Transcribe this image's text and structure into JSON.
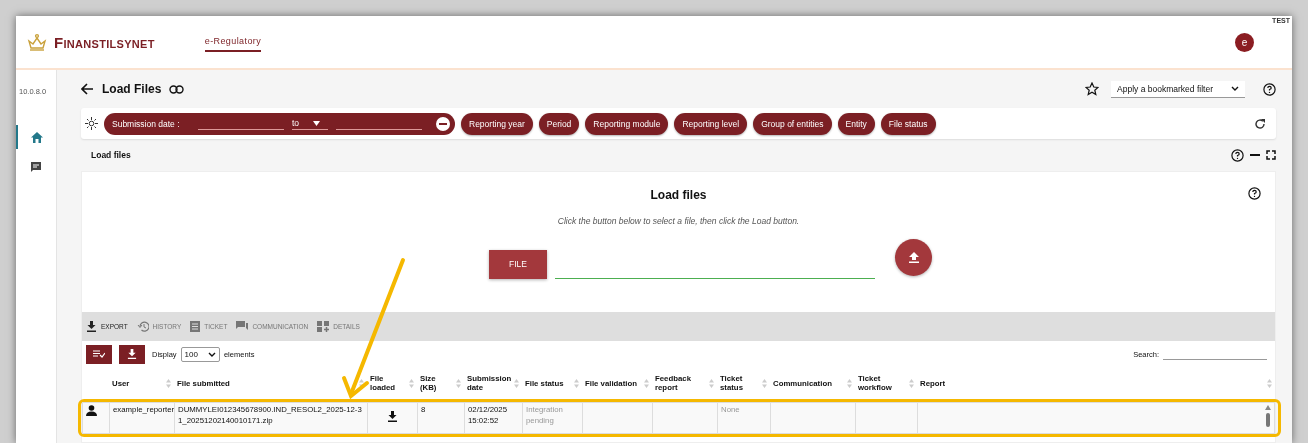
{
  "env_badge": "TEST",
  "header": {
    "brand": "Finanstilsynet",
    "nav_tab": {
      "label": "e-Regulatory",
      "selected": true
    },
    "avatar": "e"
  },
  "sidebar": {
    "version": "10.0.8.0",
    "items": [
      {
        "kind": "home",
        "selected": true
      },
      {
        "kind": "messages",
        "selected": false
      }
    ]
  },
  "page": {
    "title": "Load Files",
    "bookmark_filter": "Apply a bookmarked filter"
  },
  "filters": {
    "date_filter": {
      "label": "Submission date :",
      "range_word": "to"
    },
    "chips": [
      "Reporting year",
      "Period",
      "Reporting module",
      "Reporting level",
      "Group of entities",
      "Entity",
      "File status"
    ]
  },
  "section_label": "Load files",
  "upload": {
    "title": "Load files",
    "hint": "Click the button below to select a file, then click the Load button.",
    "file_button": "FILE"
  },
  "toolbar": [
    {
      "kind": "export",
      "label": "EXPORT",
      "disabled": false
    },
    {
      "kind": "history",
      "label": "HISTORY",
      "disabled": true
    },
    {
      "kind": "ticket",
      "label": "TICKET",
      "disabled": true
    },
    {
      "kind": "communication",
      "label": "COMMUNICATION",
      "disabled": true
    },
    {
      "kind": "details",
      "label": "DETAILS",
      "disabled": true
    }
  ],
  "table_controls": {
    "display_label": "Display",
    "page_size": "100",
    "elements_label": "elements",
    "search_label": "Search:"
  },
  "table": {
    "columns": [
      "User",
      "File submitted",
      "File loaded",
      "Size (KB)",
      "Submission date",
      "File status",
      "File validation",
      "Feedback report",
      "Ticket status",
      "Communication",
      "Ticket workflow",
      "Report"
    ],
    "rows": [
      {
        "highlighted": true,
        "user": "example_reporter",
        "file": "DUMMYLEI012345678900.IND_RESOL2_2025-12-31_20251202140010171.zip",
        "size": "8",
        "date": "02/12/2025 15:02:52",
        "file_status": "Integration pending",
        "ticket_status": "None"
      }
    ]
  }
}
